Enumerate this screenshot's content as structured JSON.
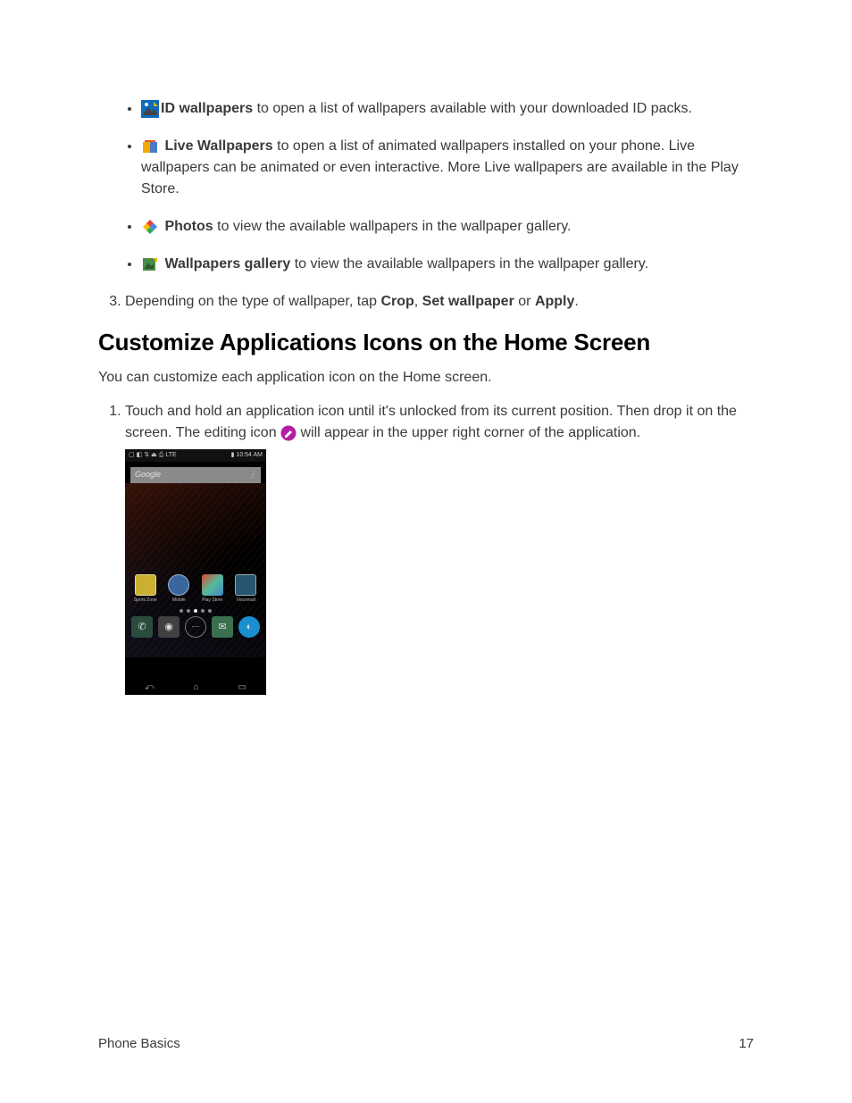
{
  "bullets": {
    "id_wallpapers": {
      "label": "ID wallpapers",
      "rest": " to open a list of wallpapers available with your downloaded ID packs."
    },
    "live_wallpapers": {
      "label": "Live Wallpapers",
      "rest": " to open a list of animated wallpapers installed on your phone. Live wallpapers can be animated or even interactive. More Live wallpapers are available in the Play Store."
    },
    "photos": {
      "label": "Photos",
      "rest": " to view the available wallpapers in the wallpaper gallery."
    },
    "wallpapers_gallery": {
      "label": "Wallpapers gallery",
      "rest": " to view the available wallpapers in the wallpaper gallery."
    }
  },
  "step3": {
    "pre": "Depending on the type of wallpaper, tap ",
    "crop": "Crop",
    "sep1": ", ",
    "set": "Set wallpaper",
    "sep2": " or ",
    "apply": "Apply",
    "end": "."
  },
  "heading": "Customize Applications Icons on the Home Screen",
  "intro": "You can customize each application icon on the Home screen.",
  "step1": {
    "part1": "Touch and hold an application icon until it's unlocked from its current position. Then drop it on the screen. The editing icon ",
    "part2": " will appear in the upper right corner of the application."
  },
  "screenshot": {
    "time": "10:54 AM",
    "status_lte": "LTE",
    "search_placeholder": "Google",
    "apps": {
      "sprint": "Sprint Zone",
      "mobile": "Mobile",
      "play": "Play Store",
      "voicemail": "Voicemail"
    }
  },
  "footer": {
    "left": "Phone Basics",
    "right": "17"
  }
}
